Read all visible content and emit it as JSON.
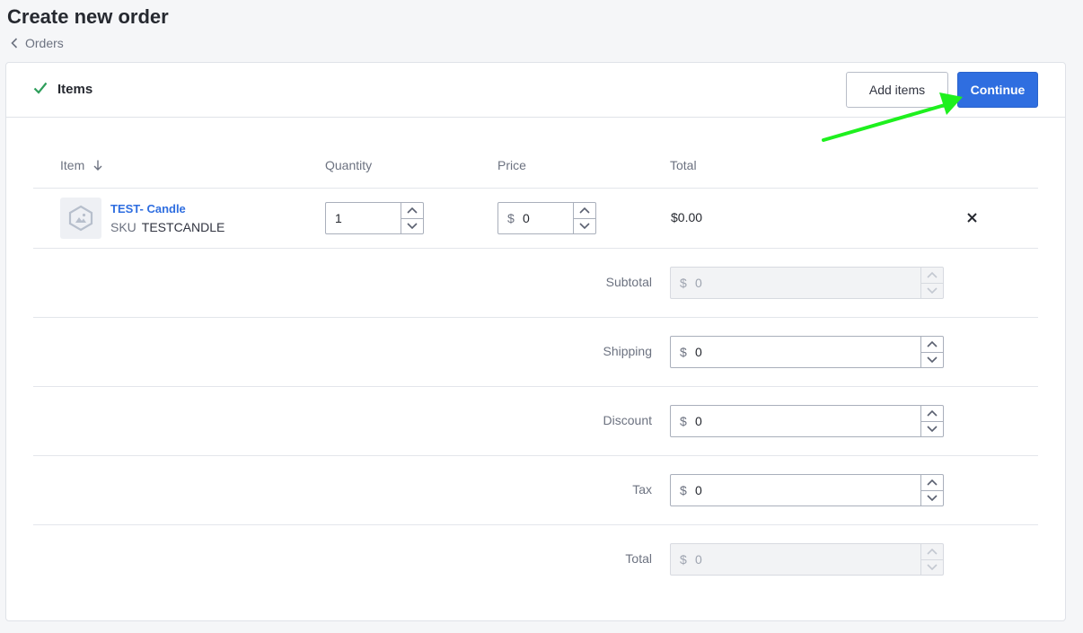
{
  "page": {
    "title": "Create new order",
    "breadcrumb": "Orders"
  },
  "card": {
    "title": "Items",
    "add_items_label": "Add items",
    "continue_label": "Continue"
  },
  "table": {
    "headers": {
      "item": "Item",
      "quantity": "Quantity",
      "price": "Price",
      "total": "Total"
    }
  },
  "item": {
    "name": "TEST- Candle",
    "sku_label": "SKU",
    "sku": "TESTCANDLE",
    "quantity": "1",
    "price_prefix": "$",
    "price": "0",
    "total": "$0.00"
  },
  "summary": {
    "subtotal": {
      "label": "Subtotal",
      "prefix": "$",
      "value": "0"
    },
    "shipping": {
      "label": "Shipping",
      "prefix": "$",
      "value": "0"
    },
    "discount": {
      "label": "Discount",
      "prefix": "$",
      "value": "0"
    },
    "tax": {
      "label": "Tax",
      "prefix": "$",
      "value": "0"
    },
    "total": {
      "label": "Total",
      "prefix": "$",
      "value": "0"
    }
  },
  "colors": {
    "primary": "#2f6ee0",
    "check": "#2e9e5b",
    "annotation_arrow": "#1ef01e"
  }
}
